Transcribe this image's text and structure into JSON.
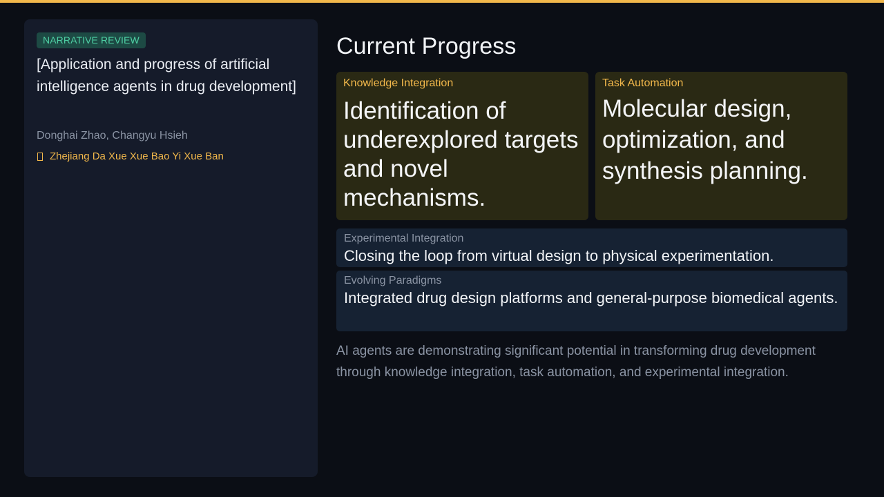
{
  "colors": {
    "accent": "#f2b84b",
    "background": "#0b0e15",
    "panel": "#151b2a",
    "badge_text": "#4fd1a5",
    "badge_bg": "#1d4a44",
    "highlight_card": "#2a2914",
    "secondary_card": "#162233"
  },
  "paper": {
    "badge": "NARRATIVE REVIEW",
    "title": "[Application and progress of artificial intelligence agents in drug development]",
    "authors": "Donghai Zhao, Changyu Hsieh",
    "journal_icon": "book-icon",
    "journal": "Zhejiang Da Xue Xue Bao Yi Xue Ban"
  },
  "main": {
    "title": "Current Progress",
    "highlights": [
      {
        "label": "Knowledge Integration",
        "text": "Identification of underexplored targets and novel mechanisms."
      },
      {
        "label": "Task Automation",
        "text": "Molecular design, optimization, and synthesis planning."
      }
    ],
    "details": [
      {
        "label": "Experimental Integration",
        "text": "Closing the loop from virtual design to physical experimentation."
      },
      {
        "label": "Evolving Paradigms",
        "text": "Integrated drug design platforms and general-purpose biomedical agents."
      }
    ],
    "summary": "AI agents are demonstrating significant potential in transforming drug development through knowledge integration, task automation, and experimental integration."
  }
}
